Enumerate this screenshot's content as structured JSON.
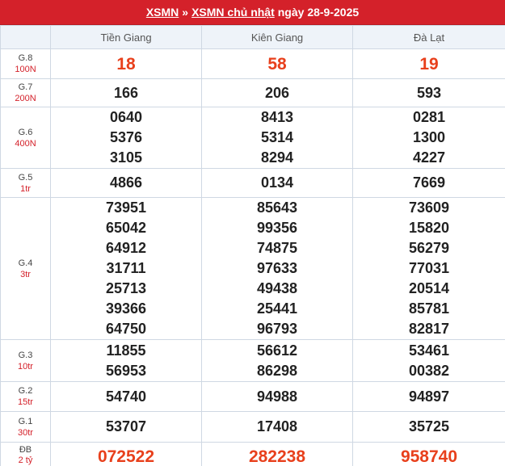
{
  "header": {
    "link1": "XSMN",
    "separator": "»",
    "link2": "XSMN chủ nhật",
    "date_text": "ngày 28-9-2025"
  },
  "columns": [
    "",
    "Tiền Giang",
    "Kiên Giang",
    "Đà Lạt"
  ],
  "prizes": [
    {
      "name": "G.8",
      "amount": "100N",
      "tg": [
        "18"
      ],
      "kg": [
        "58"
      ],
      "dl": [
        "19"
      ]
    },
    {
      "name": "G.7",
      "amount": "200N",
      "tg": [
        "166"
      ],
      "kg": [
        "206"
      ],
      "dl": [
        "593"
      ]
    },
    {
      "name": "G.6",
      "amount": "400N",
      "tg": [
        "0640",
        "5376",
        "3105"
      ],
      "kg": [
        "8413",
        "5314",
        "8294"
      ],
      "dl": [
        "0281",
        "1300",
        "4227"
      ]
    },
    {
      "name": "G.5",
      "amount": "1tr",
      "tg": [
        "4866"
      ],
      "kg": [
        "0134"
      ],
      "dl": [
        "7669"
      ]
    },
    {
      "name": "G.4",
      "amount": "3tr",
      "tg": [
        "73951",
        "65042",
        "64912",
        "31711",
        "25713",
        "39366",
        "64750"
      ],
      "kg": [
        "85643",
        "99356",
        "74875",
        "97633",
        "49438",
        "25441",
        "96793"
      ],
      "dl": [
        "73609",
        "15820",
        "56279",
        "77031",
        "20514",
        "85781",
        "82817"
      ]
    },
    {
      "name": "G.3",
      "amount": "10tr",
      "tg": [
        "11855",
        "56953"
      ],
      "kg": [
        "56612",
        "86298"
      ],
      "dl": [
        "53461",
        "00382"
      ]
    },
    {
      "name": "G.2",
      "amount": "15tr",
      "tg": [
        "54740"
      ],
      "kg": [
        "94988"
      ],
      "dl": [
        "94897"
      ]
    },
    {
      "name": "G.1",
      "amount": "30tr",
      "tg": [
        "53707"
      ],
      "kg": [
        "17408"
      ],
      "dl": [
        "35725"
      ]
    },
    {
      "name": "ĐB",
      "amount": "2 tỷ",
      "tg": [
        "072522"
      ],
      "kg": [
        "282238"
      ],
      "dl": [
        "958740"
      ]
    }
  ],
  "colors": {
    "header_bg": "#d4212a",
    "highlight": "#e8401c",
    "amount": "#d4212a"
  }
}
